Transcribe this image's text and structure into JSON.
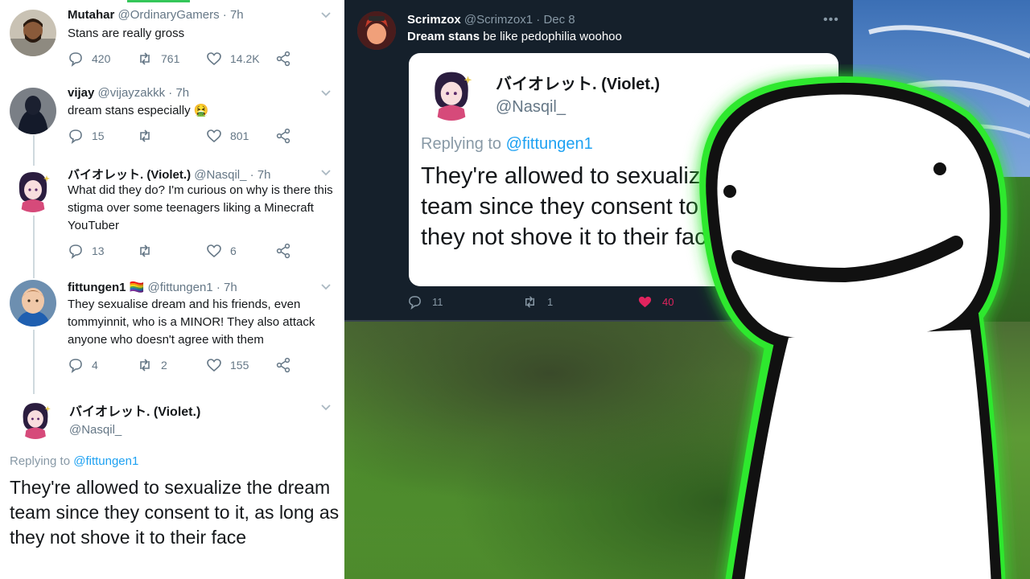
{
  "thread": {
    "tweets": [
      {
        "name": "Mutahar",
        "handle": "@OrdinaryGamers",
        "time": "· 7h",
        "text": "Stans are really gross",
        "replies": "420",
        "retweets": "761",
        "likes": "14.2K"
      },
      {
        "name": "vijay",
        "handle": "@vijayzakkk",
        "time": "· 7h",
        "text": "dream stans especially 🤮",
        "replies": "15",
        "retweets": "",
        "likes": "801"
      },
      {
        "name": "バイオレット. (Violet.)",
        "handle": "@Nasqil_",
        "time": "· 7h",
        "text": "What did they do? I'm curious on why is there this stigma over some teenagers liking a Minecraft YouTuber",
        "replies": "13",
        "retweets": "",
        "likes": "6"
      },
      {
        "name": "fittungen1 🏳️‍🌈",
        "handle": "@fittungen1",
        "time": "· 7h",
        "text": "They sexualise dream and his friends, even tommyinnit, who is a MINOR! They also attack anyone who doesn't agree with them",
        "replies": "4",
        "retweets": "2",
        "likes": "155"
      }
    ],
    "main_tweet": {
      "name": "バイオレット. (Violet.)",
      "handle": "@Nasqil_",
      "replying_prefix": "Replying to",
      "replying_to": "@fittungen1",
      "text": "They're allowed to sexualize the dream team since they consent to it, as long as they not shove it to their face"
    }
  },
  "dark_tweet": {
    "name": "Scrimzox",
    "handle": "@Scrimzox1",
    "time": "· Dec 8",
    "text_bold": "Dream stans",
    "text_rest": " be like pedophilia woohoo",
    "more": "•••",
    "quote": {
      "name": "バイオレット. (Violet.)",
      "handle": "@Nasqil_",
      "replying_prefix": "Replying to",
      "replying_to": "@fittungen1",
      "text": "They're allowed to sexualize the dream team since they consent to it, as long as they not shove it to their face"
    },
    "replies": "11",
    "retweets": "1",
    "likes": "40"
  },
  "colors": {
    "twitter_blue": "#1da1f2",
    "like_pink": "#e0245e",
    "mascot_glow": "#2ee82e",
    "dark_bg": "#15202b"
  }
}
